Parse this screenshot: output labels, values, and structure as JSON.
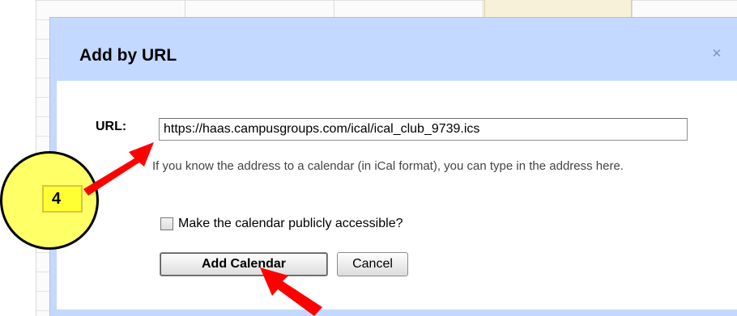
{
  "dialog": {
    "title": "Add by URL",
    "close_glyph": "✕",
    "url_label": "URL:",
    "url_value": "https://haas.campusgroups.com/ical/ical_club_9739.ics",
    "hint": "If you know the address to a calendar (in iCal format), you can type in the address here.",
    "public_label": "Make the calendar publicly accessible?",
    "public_checked": false,
    "add_button": "Add Calendar",
    "cancel_button": "Cancel"
  },
  "annotation": {
    "step_number": "4",
    "arrow_color": "#ff0000",
    "badge_color": "#ffff66"
  },
  "colors": {
    "dialog_frame": "#c3d9ff",
    "title_text": "#000000",
    "hint_text": "#444444"
  },
  "icons": {
    "close": "close-icon",
    "arrow": "arrow-icon"
  }
}
